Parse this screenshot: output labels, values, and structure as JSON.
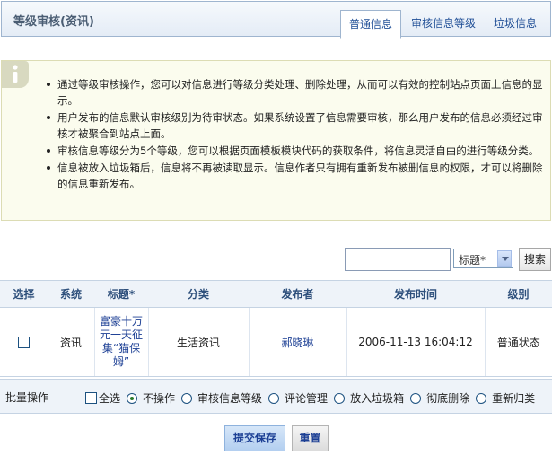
{
  "header": {
    "title": "等级审核(资讯)",
    "tabs": [
      {
        "label": "普通信息",
        "active": true
      },
      {
        "label": "审核信息等级",
        "active": false
      },
      {
        "label": "垃圾信息",
        "active": false
      }
    ]
  },
  "info": {
    "icon": "info-icon",
    "items": [
      "通过等级审核操作，您可以对信息进行等级分类处理、删除处理，从而可以有效的控制站点页面上信息的显示。",
      "用户发布的信息默认审核级别为待审状态。如果系统设置了信息需要审核，那么用户发布的信息必须经过审核才被聚合到站点上面。",
      "审核信息等级分为5个等级，您可以根据页面模板模块代码的获取条件，将信息灵活自由的进行等级分类。",
      "信息被放入垃圾箱后，信息将不再被读取显示。信息作者只有拥有重新发布被删信息的权限，才可以将删除的信息重新发布。"
    ]
  },
  "search": {
    "value": "",
    "select_value": "标题*",
    "button_label": "搜索"
  },
  "table": {
    "columns": [
      "选择",
      "系统",
      "标题*",
      "分类",
      "发布者",
      "发布时间",
      "级别"
    ],
    "rows": [
      {
        "checked": false,
        "system": "资讯",
        "title": "富豪十万元一天征集“猫保姆”",
        "category": "生活资讯",
        "publisher": "郝晓琳",
        "time": "2006-11-13 16:04:12",
        "level": "普通状态"
      }
    ]
  },
  "batch": {
    "label": "批量操作",
    "select_all": "全选",
    "options": [
      {
        "label": "不操作",
        "checked": true
      },
      {
        "label": "审核信息等级",
        "checked": false
      },
      {
        "label": "评论管理",
        "checked": false
      },
      {
        "label": "放入垃圾箱",
        "checked": false
      },
      {
        "label": "彻底删除",
        "checked": false
      },
      {
        "label": "重新归类",
        "checked": false
      }
    ]
  },
  "buttons": {
    "save": "提交保存",
    "reset": "重置"
  },
  "colors": {
    "header_bg": "#e4ecf6",
    "info_bg": "#fbfcee",
    "table_header_bg": "#eef3f9",
    "link": "#1c3f94"
  }
}
